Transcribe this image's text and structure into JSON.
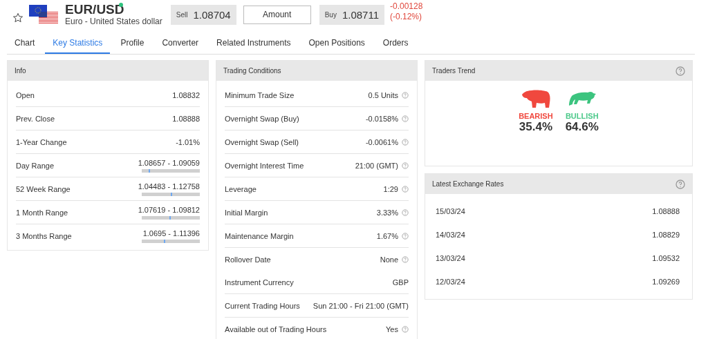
{
  "instrument": {
    "symbol": "EUR/USD",
    "name": "Euro - United States dollar",
    "favorite": false,
    "live": true
  },
  "quote": {
    "sell_label": "Sell",
    "sell": "1.08704",
    "amount_placeholder": "Amount",
    "buy_label": "Buy",
    "buy": "1.08711",
    "change": "-0.00128",
    "change_pct": "(-0.12%)"
  },
  "tabs": [
    {
      "label": "Chart",
      "selected": false
    },
    {
      "label": "Key Statistics",
      "selected": true
    },
    {
      "label": "Profile",
      "selected": false
    },
    {
      "label": "Converter",
      "selected": false
    },
    {
      "label": "Related Instruments",
      "selected": false
    },
    {
      "label": "Open Positions",
      "selected": false
    },
    {
      "label": "Orders",
      "selected": false
    }
  ],
  "info": {
    "title": "Info",
    "rows": [
      {
        "label": "Open",
        "value": "1.08832"
      },
      {
        "label": "Prev. Close",
        "value": "1.08888"
      },
      {
        "label": "1-Year Change",
        "value": "-1.01%"
      },
      {
        "label": "Day Range",
        "value": "1.08657 - 1.09059",
        "level": 0.12
      },
      {
        "label": "52 Week Range",
        "value": "1.04483 - 1.12758",
        "level": 0.5
      },
      {
        "label": "1 Month Range",
        "value": "1.07619 - 1.09812",
        "level": 0.48
      },
      {
        "label": "3 Months Range",
        "value": "1.0695 - 1.11396",
        "level": 0.38
      }
    ]
  },
  "trading_conditions": {
    "title": "Trading Conditions",
    "rows": [
      {
        "label": "Minimum Trade Size",
        "value": "0.5 Units",
        "help": true
      },
      {
        "label": "Overnight Swap (Buy)",
        "value": "-0.0158%",
        "help": true
      },
      {
        "label": "Overnight Swap (Sell)",
        "value": "-0.0061%",
        "help": true
      },
      {
        "label": "Overnight Interest Time",
        "value": "21:00 (GMT)",
        "help": true
      },
      {
        "label": "Leverage",
        "value": "1:29",
        "help": true
      },
      {
        "label": "Initial Margin",
        "value": "3.33%",
        "help": true
      },
      {
        "label": "Maintenance Margin",
        "value": "1.67%",
        "help": true
      },
      {
        "label": "Rollover Date",
        "value": "None",
        "help": true
      },
      {
        "label": "Instrument Currency",
        "value": "GBP",
        "help": false
      },
      {
        "label": "Current Trading Hours",
        "value": "Sun 21:00 - Fri 21:00 (GMT)",
        "help": false
      },
      {
        "label": "Available out of Trading Hours",
        "value": "Yes",
        "help": true
      }
    ]
  },
  "traders_trend": {
    "title": "Traders Trend",
    "bearish_label": "BEARISH",
    "bearish": "35.4%",
    "bullish_label": "BULLISH",
    "bullish": "64.6%"
  },
  "latest_rates": {
    "title": "Latest Exchange Rates",
    "rows": [
      {
        "date": "15/03/24",
        "value": "1.08888"
      },
      {
        "date": "14/03/24",
        "value": "1.08829"
      },
      {
        "date": "13/03/24",
        "value": "1.09532"
      },
      {
        "date": "12/03/24",
        "value": "1.09269"
      }
    ]
  }
}
